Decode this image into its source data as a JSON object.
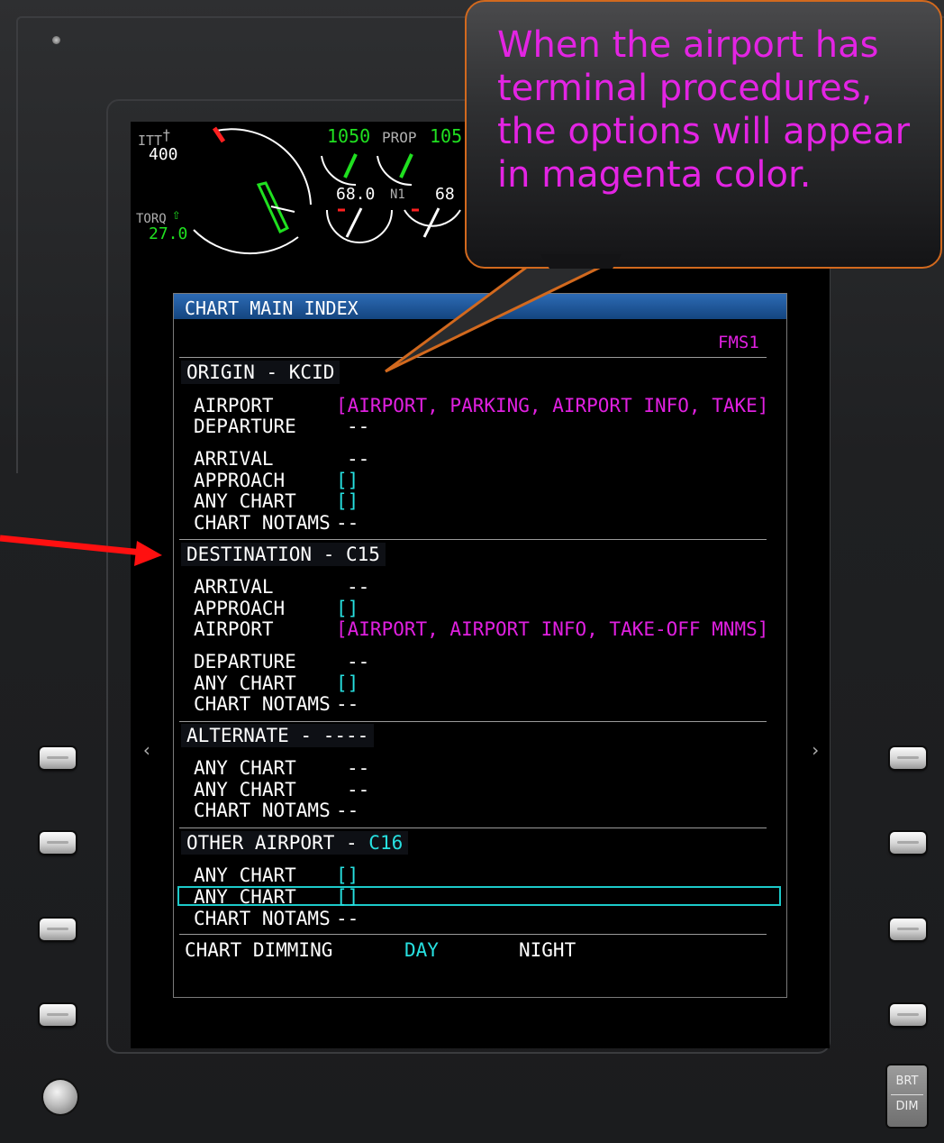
{
  "callout": {
    "text": "When the airport has terminal procedures, the options will appear in magenta color."
  },
  "engine": {
    "itt_label": "ITT",
    "itt_value": "400",
    "torq_label": "TORQ",
    "torq_value": "27.0",
    "prop_left": "1050",
    "prop_label": "PROP",
    "prop_right": "105",
    "n1_left": "68.0",
    "n1_label": "N1",
    "n1_right": "68"
  },
  "chart_index": {
    "title": "CHART MAIN INDEX",
    "fms": "FMS1",
    "origin": {
      "header": "ORIGIN - KCID",
      "airport_label": "AIRPORT",
      "airport_value": "[AIRPORT, PARKING, AIRPORT INFO, TAKE]",
      "departure_label": "DEPARTURE",
      "departure_value": "--",
      "arrival_label": "ARRIVAL",
      "arrival_value": "--",
      "approach_label": "APPROACH",
      "approach_value": "[]",
      "any_chart_label": "ANY CHART",
      "any_chart_value": "[]",
      "notams_label": "CHART NOTAMS",
      "notams_value": "--"
    },
    "destination": {
      "header_prefix": "DESTINATION - ",
      "header_id": "C15",
      "arrival_label": "ARRIVAL",
      "arrival_value": "--",
      "approach_label": "APPROACH",
      "approach_value": "[]",
      "airport_label": "AIRPORT",
      "airport_value": "[AIRPORT, AIRPORT INFO, TAKE-OFF MNMS]",
      "departure_label": "DEPARTURE",
      "departure_value": "--",
      "any_chart_label": "ANY CHART",
      "any_chart_value": "[]",
      "notams_label": "CHART NOTAMS",
      "notams_value": "--"
    },
    "alternate": {
      "header": "ALTERNATE - ----",
      "any_chart_1_label": "ANY CHART",
      "any_chart_1_value": "--",
      "any_chart_2_label": "ANY CHART",
      "any_chart_2_value": "--",
      "notams_label": "CHART NOTAMS",
      "notams_value": "--"
    },
    "other": {
      "header_prefix": "OTHER AIRPORT - ",
      "header_id": "C16",
      "any_chart_1_label": "ANY CHART",
      "any_chart_1_value": "[]",
      "any_chart_2_label": "ANY CHART",
      "any_chart_2_value": "[]",
      "notams_label": "CHART NOTAMS",
      "notams_value": "--"
    },
    "dimming": {
      "label": "CHART DIMMING",
      "day": "DAY",
      "night": "NIGHT"
    },
    "nav_left": "‹",
    "nav_right": "›"
  },
  "bezel": {
    "brt": "BRT",
    "dim": "DIM"
  },
  "colors": {
    "magenta": "#e020e0",
    "cyan": "#27e0e0",
    "header_blue": "#1f5aa0",
    "callout_border": "#d2691e",
    "arrow_red": "#ff1010"
  }
}
